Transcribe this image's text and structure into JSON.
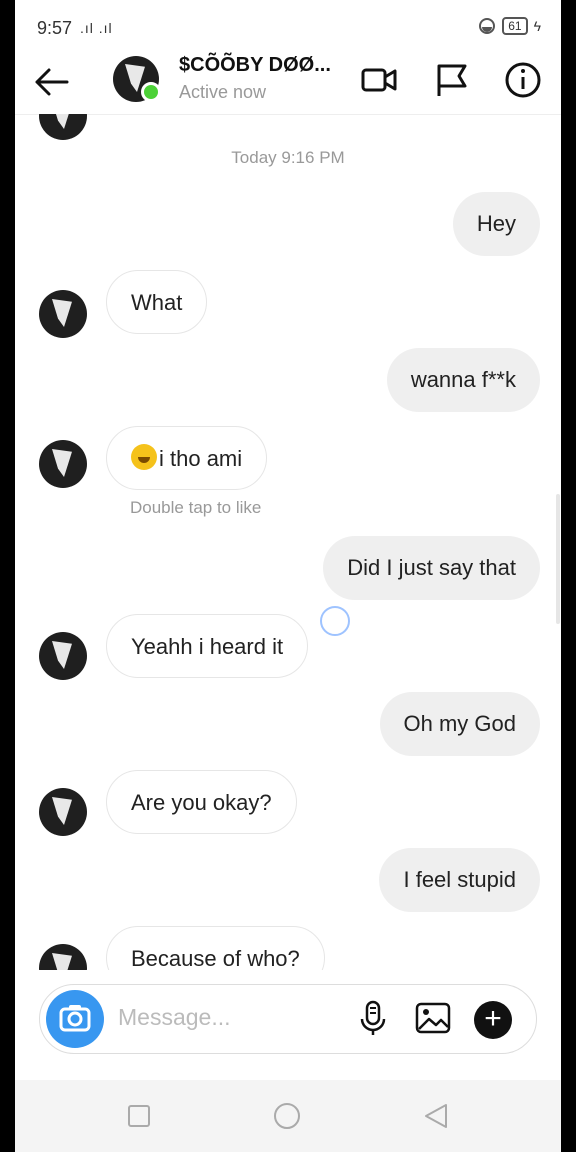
{
  "status_bar": {
    "time": "9:57",
    "signal": ".ıl .ıl",
    "battery": "61"
  },
  "header": {
    "title": "$CÕÕBY DØØ...",
    "subtitle": "Active now"
  },
  "chat": {
    "timestamp": "Today 9:16 PM",
    "messages": [
      {
        "dir": "out",
        "text": "Hey"
      },
      {
        "dir": "in",
        "text": "What"
      },
      {
        "dir": "out",
        "text": "wanna f**k"
      },
      {
        "dir": "in",
        "text": "i tho ami",
        "emoji": "rolling-on-floor-laughing"
      },
      {
        "dir": "out",
        "text": "Did I just say that"
      },
      {
        "dir": "in",
        "text": "Yeahh i heard it"
      },
      {
        "dir": "out",
        "text": "Oh my God"
      },
      {
        "dir": "in",
        "text": "Are you okay?"
      },
      {
        "dir": "out",
        "text": "I feel stupid"
      },
      {
        "dir": "in",
        "text": "Because of who?"
      }
    ],
    "like_hint": "Double tap to like"
  },
  "composer": {
    "placeholder": "Message..."
  },
  "icons": {
    "back": "arrow-left-icon",
    "video": "video-camera-icon",
    "flag": "flag-icon",
    "info": "info-icon",
    "camera": "camera-icon",
    "mic": "microphone-icon",
    "gallery": "image-icon",
    "plus": "plus-icon",
    "nav_recents": "square-icon",
    "nav_home": "circle-icon",
    "nav_back": "triangle-back-icon"
  },
  "colors": {
    "accent": "#3897f0",
    "online": "#4cd137",
    "outgoing_bubble": "#efefef"
  }
}
